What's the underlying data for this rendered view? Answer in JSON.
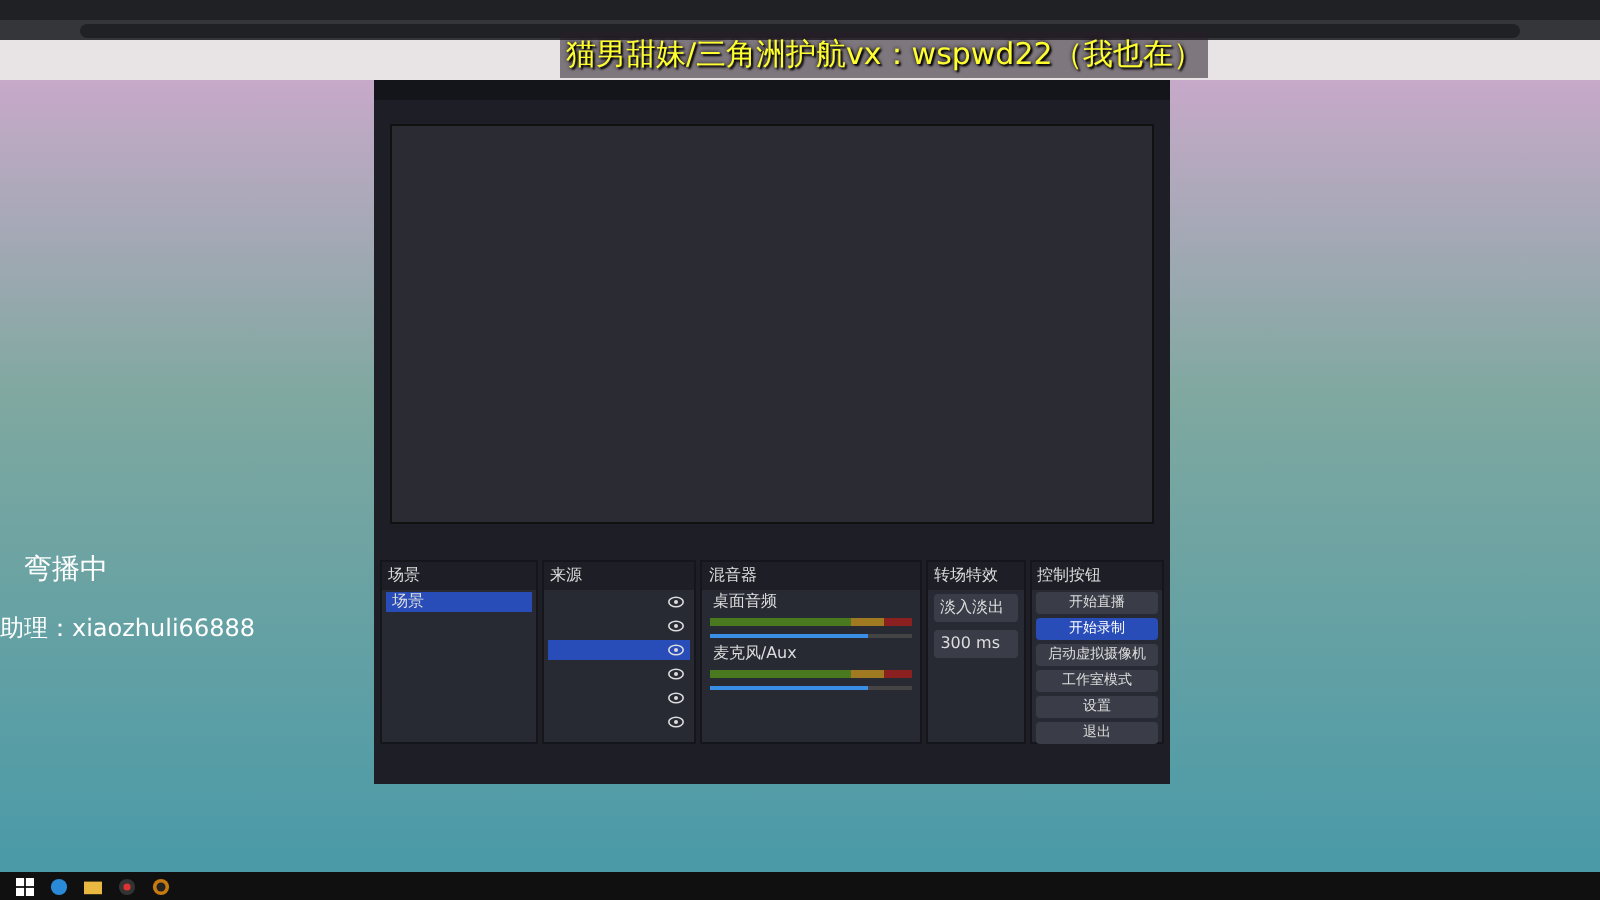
{
  "overlay_text": "猫男甜妹/三角洲护航vx：wspwd22（我也在）",
  "stream_labels": [
    "弯播中",
    "助理：xiaozhuli66888"
  ],
  "obs": {
    "scenes": {
      "title": "场景",
      "items": [
        {
          "label": "场景",
          "selected": true
        }
      ]
    },
    "sources": {
      "title": "来源",
      "items": [
        {
          "selected": false,
          "visible": true
        },
        {
          "selected": false,
          "visible": true
        },
        {
          "selected": true,
          "visible": true
        },
        {
          "selected": false,
          "visible": true
        },
        {
          "selected": false,
          "visible": true
        },
        {
          "selected": false,
          "visible": true
        }
      ]
    },
    "mixer": {
      "title": "混音器",
      "channels": [
        {
          "name": "桌面音频",
          "level": 0.78
        },
        {
          "name": "麦克风/Aux",
          "level": 0.78
        }
      ]
    },
    "transitions": {
      "title": "转场特效",
      "type": "淡入淡出",
      "duration": "300 ms"
    },
    "controls": {
      "title": "控制按钮",
      "buttons": [
        {
          "label": "开始直播",
          "selected": false
        },
        {
          "label": "开始录制",
          "selected": true
        },
        {
          "label": "启动虚拟摄像机",
          "selected": false
        },
        {
          "label": "工作室模式",
          "selected": false
        },
        {
          "label": "设置",
          "selected": false
        },
        {
          "label": "退出",
          "selected": false
        }
      ]
    }
  }
}
